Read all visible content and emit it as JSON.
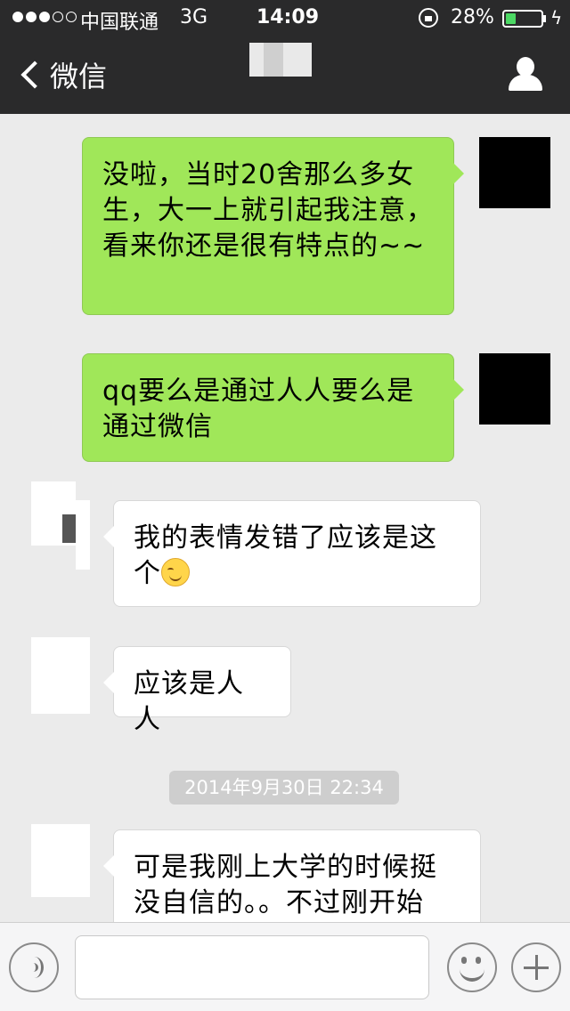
{
  "status_bar": {
    "carrier": "中国联通",
    "network": "3G",
    "time": "14:09",
    "battery_percent": "28%",
    "battery_level": 0.28
  },
  "nav": {
    "back_label": "微信",
    "back_icon": "chevron-left-icon",
    "profile_icon": "person-icon"
  },
  "messages": [
    {
      "sender": "me",
      "text": "没啦，当时20舍那么多女生，大一上就引起我注意，看来你还是很有特点的~~"
    },
    {
      "sender": "me",
      "text": "qq要么是通过人人要么是通过微信"
    },
    {
      "sender": "other",
      "text": "我的表情发错了应该是这个",
      "emoji": "smiling-face-emoji"
    },
    {
      "sender": "other",
      "text": "应该是人人"
    },
    {
      "sender": "other",
      "text": "可是我刚上大学的时候挺没自信的。。不过刚开始"
    }
  ],
  "timestamp": "2014年9月30日 22:34",
  "input_bar": {
    "voice_icon": "voice-icon",
    "text_value": "",
    "emoji_icon": "emoji-icon",
    "plus_icon": "plus-icon"
  },
  "colors": {
    "nav_background": "#2a2a2b",
    "chat_background": "#ebebeb",
    "my_bubble": "#a0e759",
    "their_bubble": "#ffffff"
  }
}
